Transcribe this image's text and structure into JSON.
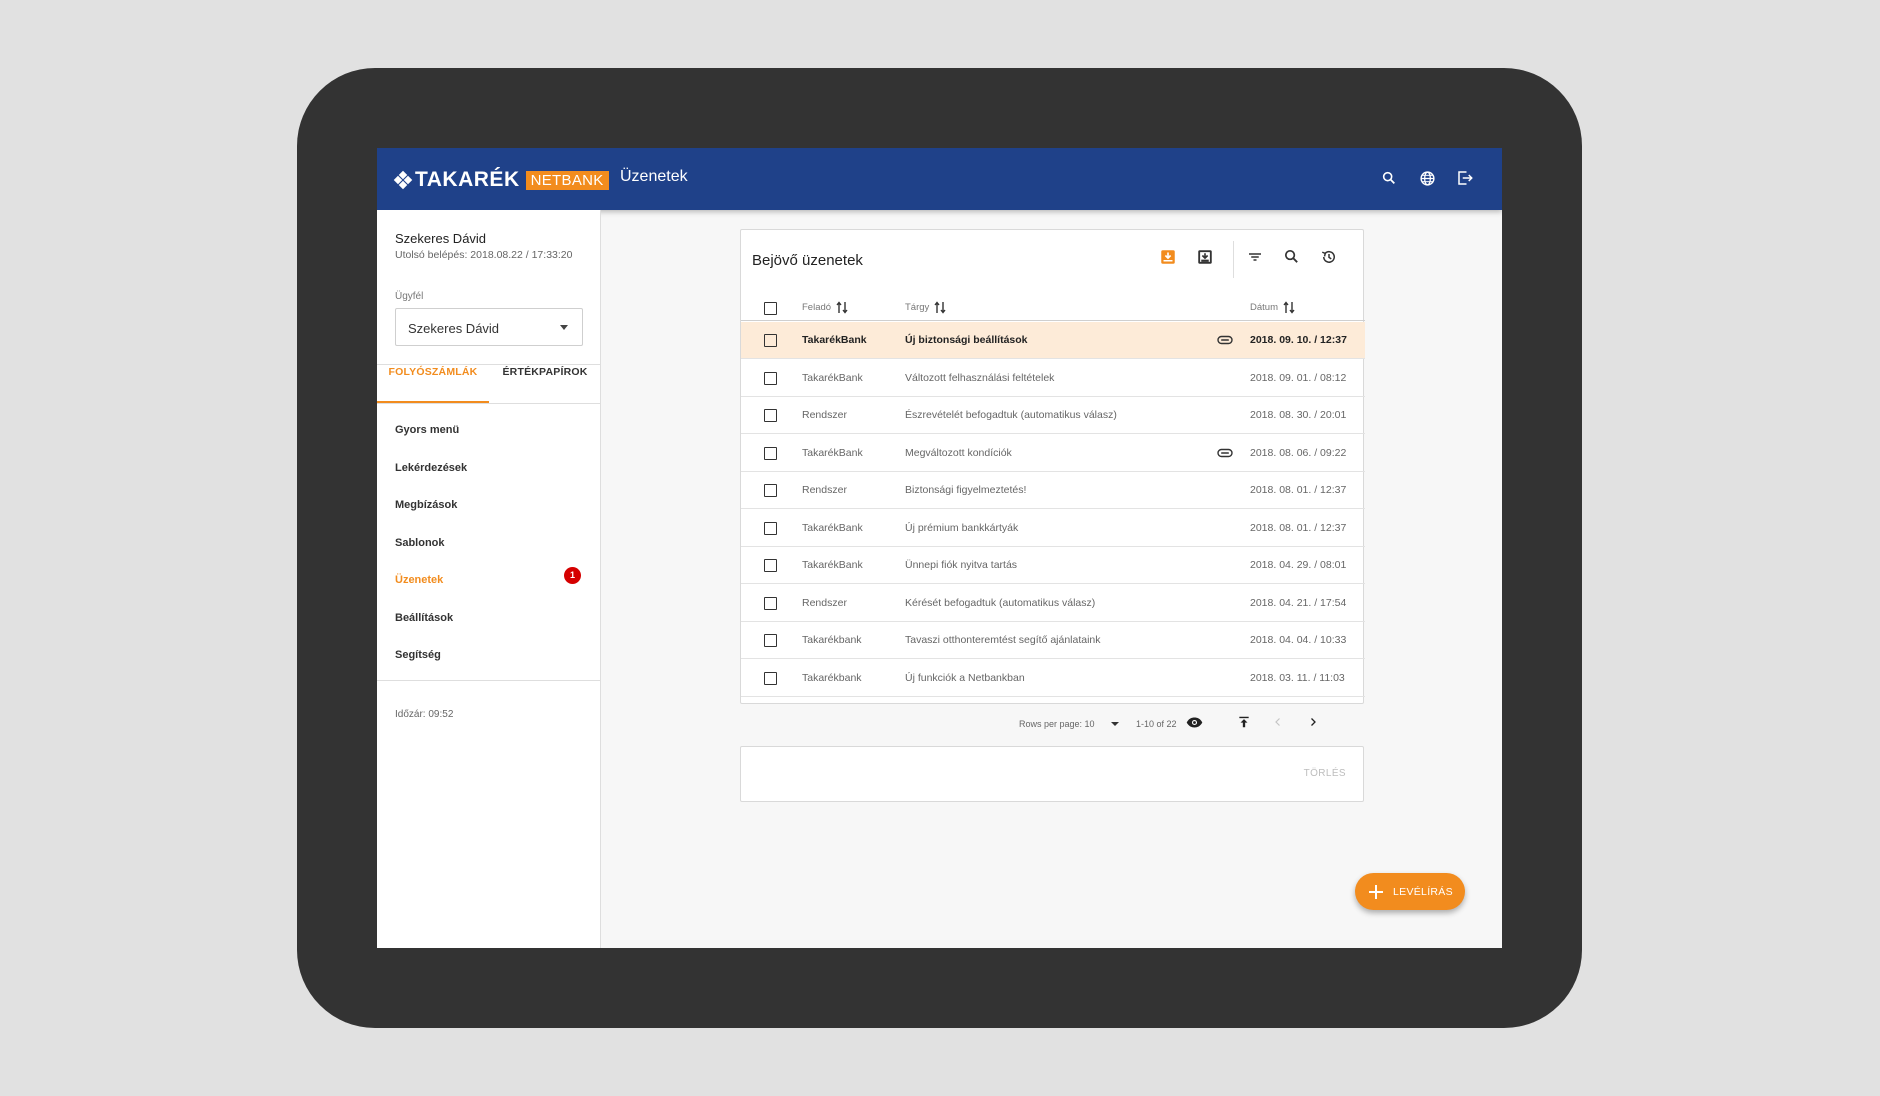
{
  "brand": {
    "logo_word": "TAKARÉK",
    "logo_badge": "NETBANK",
    "orange": "#f28c1e",
    "blue": "#1f4189"
  },
  "header": {
    "title": "Üzenetek",
    "icons": [
      "search-icon",
      "globe-icon",
      "logout-icon"
    ]
  },
  "sidebar": {
    "user_name": "Szekeres Dávid",
    "last_login": "Utolsó belépés: 2018.08.22 / 17:33:20",
    "client_label": "Ügyfél",
    "client_value": "Szekeres Dávid",
    "tabs": [
      {
        "label": "FOLYÓSZÁMLÁK",
        "active": true
      },
      {
        "label": "ÉRTÉKPAPÍROK",
        "active": false
      }
    ],
    "items": [
      {
        "label": "Gyors menü"
      },
      {
        "label": "Lekérdezések"
      },
      {
        "label": "Megbízások"
      },
      {
        "label": "Sablonok"
      },
      {
        "label": "Üzenetek",
        "active": true,
        "badge": "1"
      },
      {
        "label": "Beállítások"
      },
      {
        "label": "Segítség"
      }
    ],
    "timer": "Időzár: 09:52"
  },
  "inbox": {
    "title": "Bejövő üzenetek",
    "tool_icons": [
      "inbox-download-icon",
      "inbox-download-outline-icon",
      "filter-icon",
      "search-icon",
      "history-icon"
    ],
    "columns": {
      "sender": "Feladó",
      "subject": "Tárgy",
      "date": "Dátum"
    },
    "rows": [
      {
        "sender": "TakarékBank",
        "subject": "Új biztonsági beállítások",
        "date": "2018. 09. 10. / 12:37",
        "attachment": true,
        "highlight": true
      },
      {
        "sender": "TakarékBank",
        "subject": "Változott felhasználási feltételek",
        "date": "2018. 09. 01. / 08:12",
        "attachment": false
      },
      {
        "sender": "Rendszer",
        "subject": "Észrevételét befogadtuk (automatikus válasz)",
        "date": "2018. 08. 30. / 20:01",
        "attachment": false
      },
      {
        "sender": "TakarékBank",
        "subject": "Megváltozott kondíciók",
        "date": "2018. 08. 06. / 09:22",
        "attachment": true
      },
      {
        "sender": "Rendszer",
        "subject": "Biztonsági figyelmeztetés!",
        "date": "2018. 08. 01. / 12:37",
        "attachment": false
      },
      {
        "sender": "TakarékBank",
        "subject": "Új prémium bankkártyák",
        "date": "2018. 08. 01. / 12:37",
        "attachment": false
      },
      {
        "sender": "TakarékBank",
        "subject": "Ünnepi fiók nyitva tartás",
        "date": "2018. 04. 29. / 08:01",
        "attachment": false
      },
      {
        "sender": "Rendszer",
        "subject": "Kérését befogadtuk (automatikus válasz)",
        "date": "2018. 04. 21. / 17:54",
        "attachment": false
      },
      {
        "sender": "Takarékbank",
        "subject": "Tavaszi otthonteremtést segítő ajánlataink",
        "date": "2018. 04. 04. / 10:33",
        "attachment": false
      },
      {
        "sender": "Takarékbank",
        "subject": "Új funkciók a Netbankban",
        "date": "2018. 03. 11. / 11:03",
        "attachment": false
      }
    ],
    "pager": {
      "rows_per_page": "Rows per page: 10",
      "range": "1-10 of 22"
    },
    "delete_label": "TÖRLÉS"
  },
  "fab": {
    "label": "LEVÉLÍRÁS"
  }
}
